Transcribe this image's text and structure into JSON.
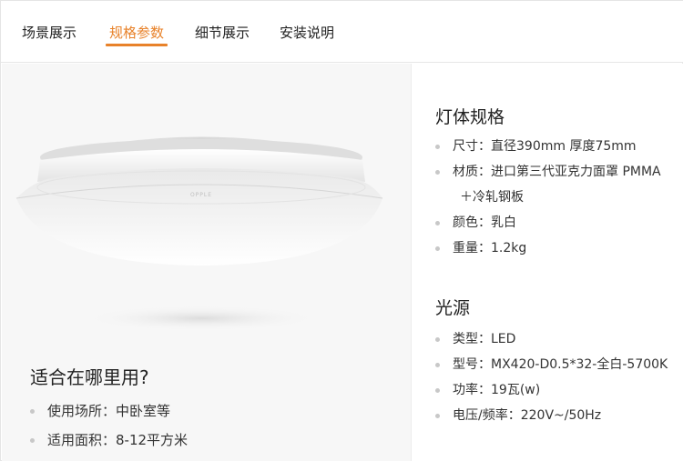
{
  "tabs": [
    "场景展示",
    "规格参数",
    "细节展示",
    "安装说明"
  ],
  "active_tab": "规格参数",
  "product": {
    "brand_mark": "OPPLE"
  },
  "usage": {
    "title": "适合在哪里用?",
    "items": [
      "使用场所：中卧室等",
      "适用面积：8-12平方米"
    ]
  },
  "specs": {
    "lamp_title": "灯体规格",
    "lamp_items": [
      "尺寸：直径390mm 厚度75mm",
      "材质：进口第三代亚克力面罩 PMMA",
      "＋冷轧钢板",
      "颜色：乳白",
      "重量：1.2kg"
    ],
    "light_title": "光源",
    "light_items": [
      "类型：LED",
      "型号：MX420-D0.5*32-全白-5700K",
      "功率：19瓦(w)",
      "电压/频率：220V~/50Hz"
    ]
  },
  "colors": {
    "accent": "#e8822a",
    "panel_bg": "#f7f7f7",
    "bullet": "#c8c8c8"
  }
}
